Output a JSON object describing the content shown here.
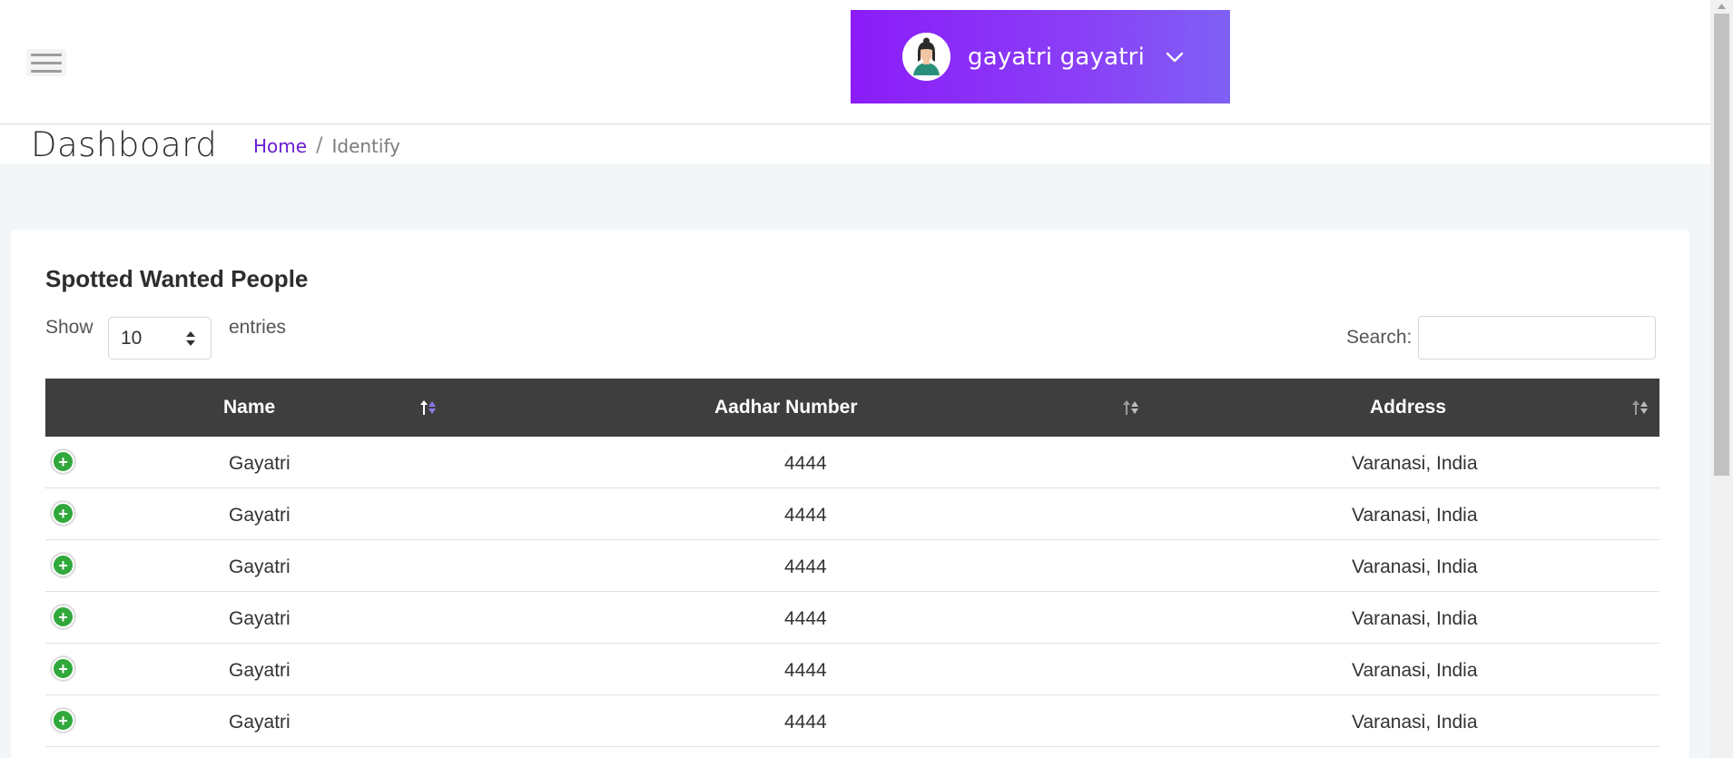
{
  "header": {
    "user_name": "gayatri gayatri",
    "accent_gradient": [
      "#8b1cf8",
      "#7f60f5"
    ]
  },
  "page": {
    "title": "Dashboard",
    "breadcrumb": {
      "home": "Home",
      "separator": "/",
      "current": "Identify"
    }
  },
  "card": {
    "title": "Spotted Wanted People",
    "length_menu": {
      "show_label": "Show",
      "selected": "10",
      "entries_label": "entries"
    },
    "search": {
      "label": "Search:",
      "value": "",
      "placeholder": ""
    },
    "table": {
      "columns": [
        "Name",
        "Aadhar Number",
        "Address"
      ],
      "sorted_column": "Name",
      "rows": [
        {
          "name": "Gayatri",
          "aadhar": "4444",
          "address": "Varanasi, India"
        },
        {
          "name": "Gayatri",
          "aadhar": "4444",
          "address": "Varanasi, India"
        },
        {
          "name": "Gayatri",
          "aadhar": "4444",
          "address": "Varanasi, India"
        },
        {
          "name": "Gayatri",
          "aadhar": "4444",
          "address": "Varanasi, India"
        },
        {
          "name": "Gayatri",
          "aadhar": "4444",
          "address": "Varanasi, India"
        },
        {
          "name": "Gayatri",
          "aadhar": "4444",
          "address": "Varanasi, India"
        }
      ],
      "expand_glyph": "+"
    }
  }
}
